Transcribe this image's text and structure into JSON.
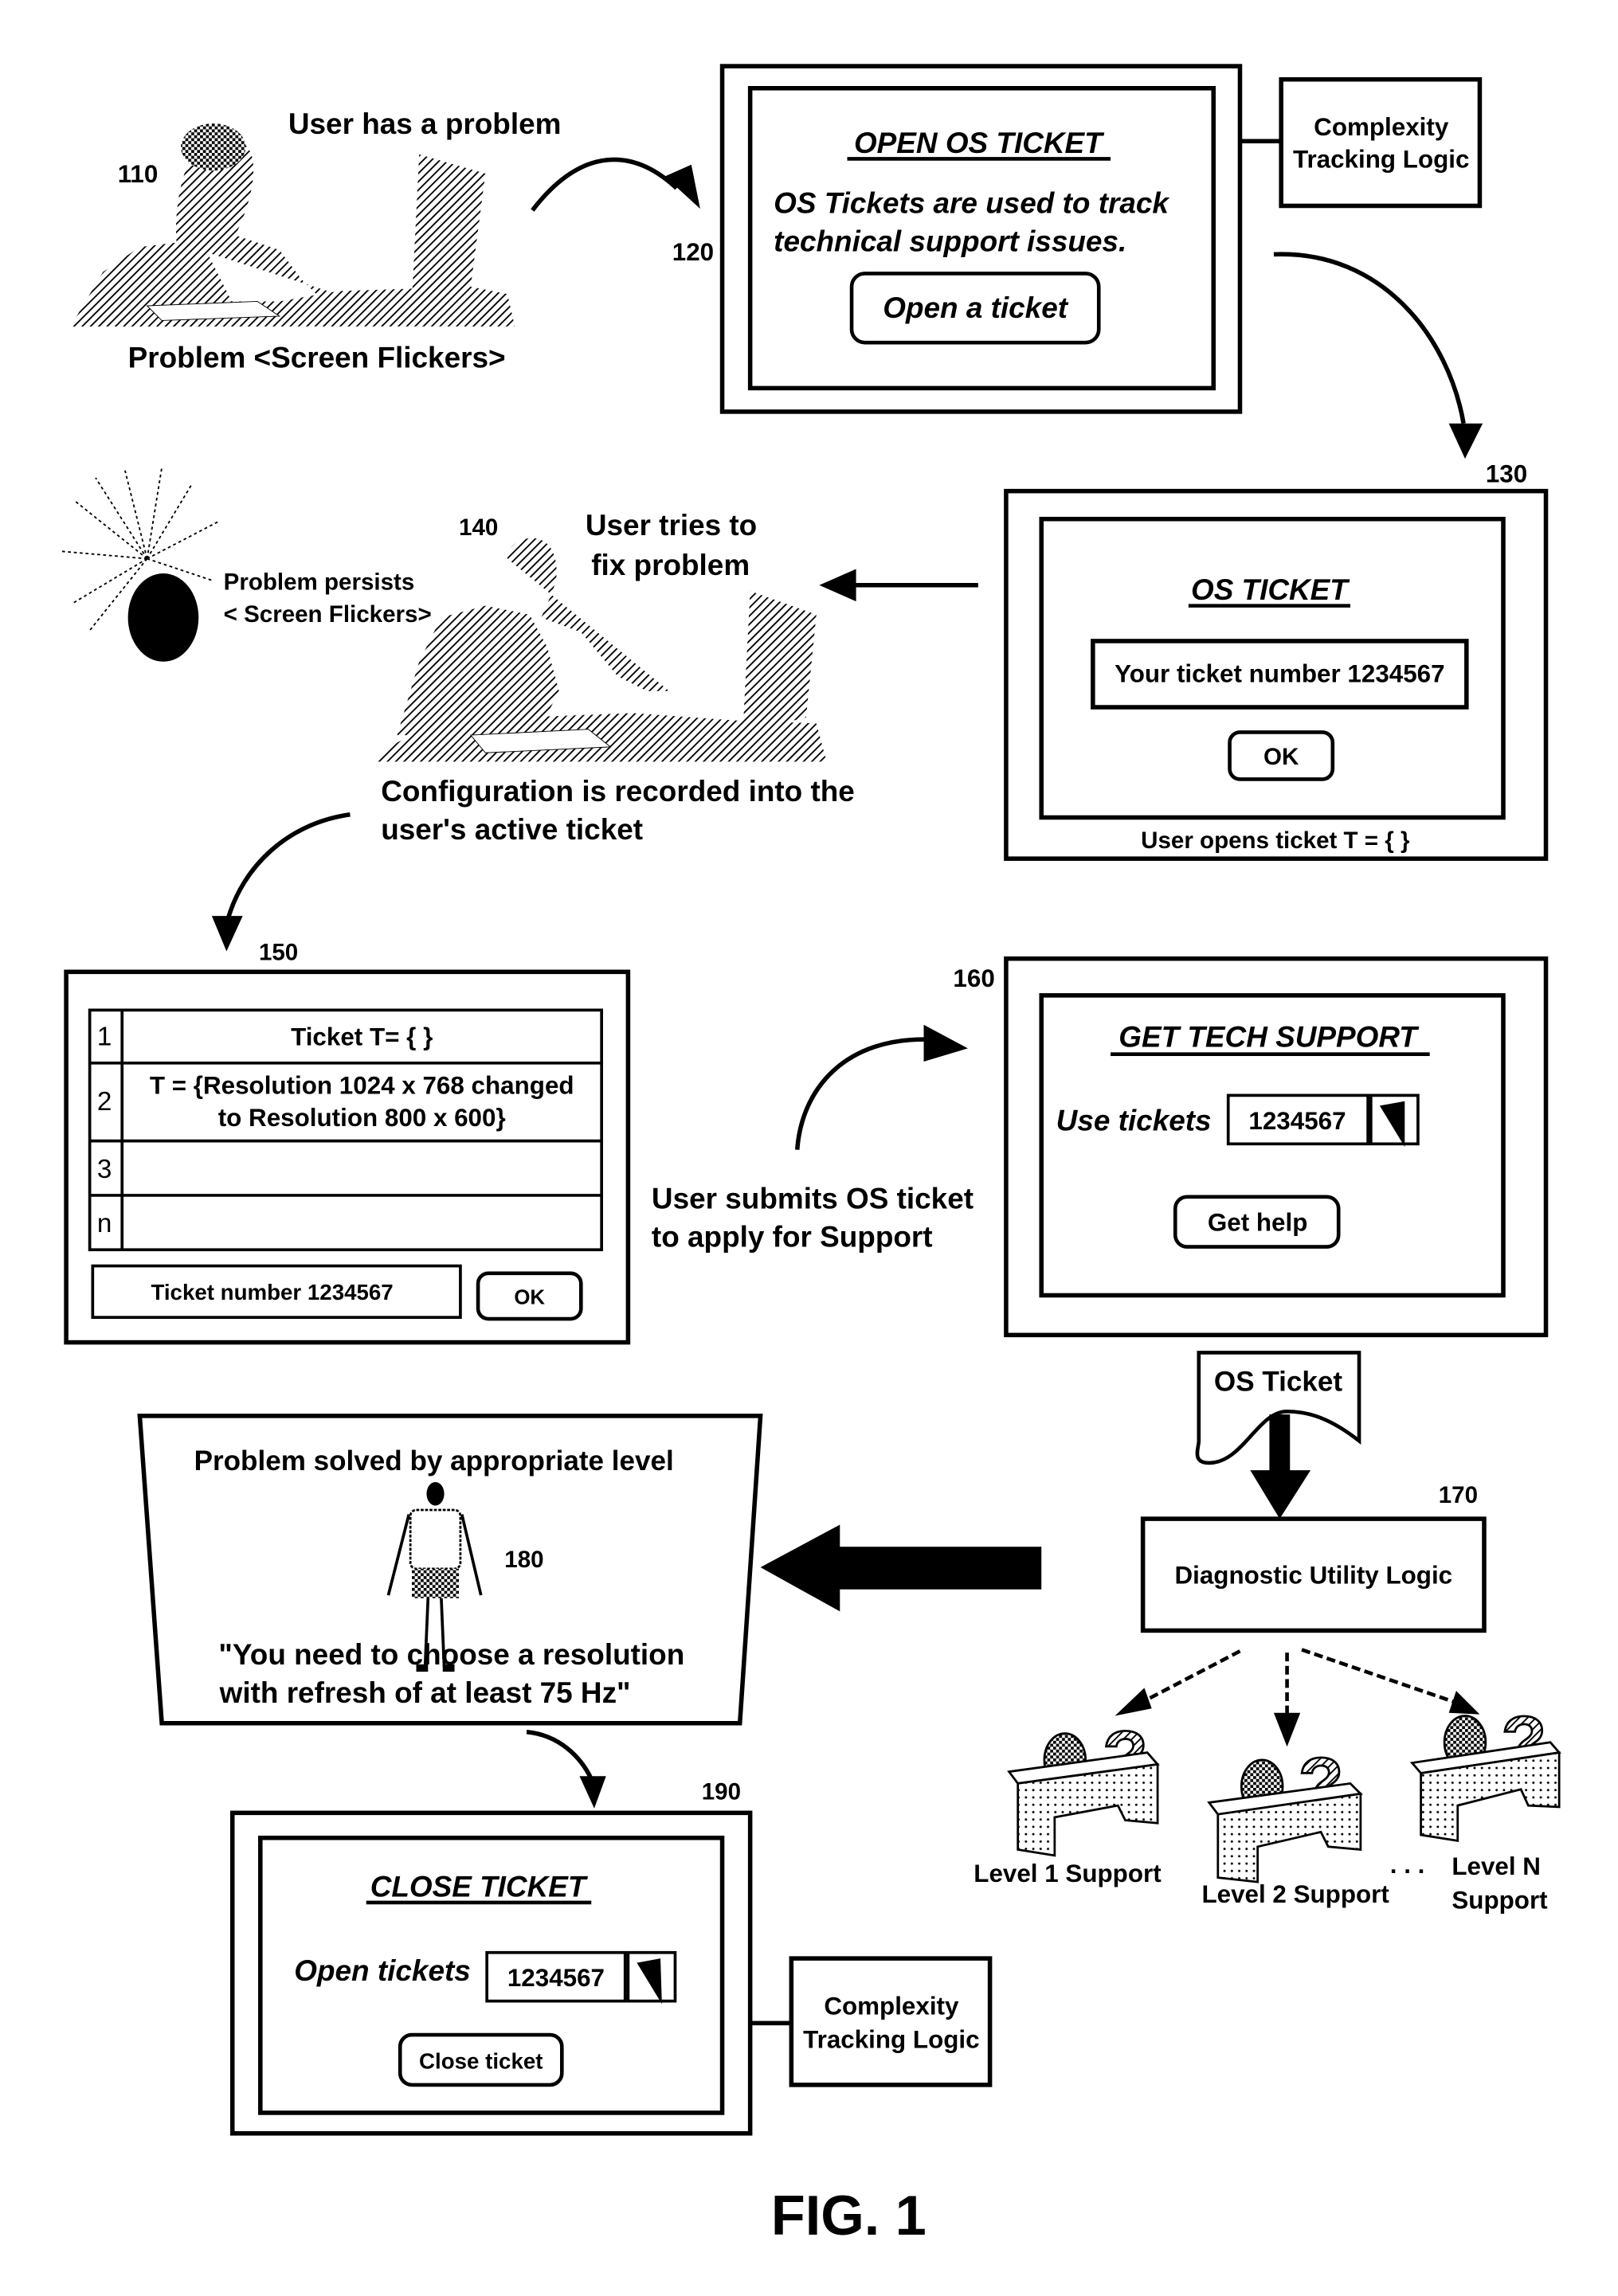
{
  "figure_label": "FIG. 1",
  "colors": {
    "ink": "#000000",
    "paper": "#ffffff",
    "hatch": "#555555",
    "dots": "#888888"
  },
  "step_110": {
    "ref": "110",
    "caption": "User has a problem",
    "problem": "Problem <Screen Flickers>"
  },
  "step_120": {
    "ref": "120",
    "title": "OPEN OS TICKET",
    "description_line1": "OS Tickets are used to track",
    "description_line2": "technical support issues.",
    "button_label": "Open a ticket",
    "side_box_line1": "Complexity",
    "side_box_line2": "Tracking Logic"
  },
  "step_130": {
    "ref": "130",
    "title": "OS TICKET",
    "ticket_field": "Your ticket number 1234567",
    "ok_label": "OK",
    "footer": "User opens ticket T = {  }"
  },
  "step_140": {
    "ref": "140",
    "caption_line1": "User tries to",
    "caption_line2": "fix problem",
    "persist_line1": "Problem persists",
    "persist_line2": "< Screen Flickers>",
    "config_line1": "Configuration is recorded into the",
    "config_line2": "user's active ticket"
  },
  "step_150": {
    "ref": "150",
    "rows": [
      {
        "index": "1",
        "line1": "Ticket T= {  }",
        "line2": ""
      },
      {
        "index": "2",
        "line1": "T = {Resolution 1024 x 768 changed",
        "line2": "to Resolution 800 x 600}"
      },
      {
        "index": "3",
        "line1": "",
        "line2": ""
      },
      {
        "index": "n",
        "line1": "",
        "line2": ""
      }
    ],
    "ticket_field": "Ticket number 1234567",
    "ok_label": "OK"
  },
  "step_160": {
    "ref": "160",
    "submit_line1": "User submits OS ticket",
    "submit_line2": "to apply for Support",
    "title": "GET TECH SUPPORT",
    "field_label": "Use tickets",
    "field_value": "1234567",
    "button_label": "Get help"
  },
  "step_170": {
    "ref": "170",
    "document_label": "OS Ticket",
    "box_label": "Diagnostic Utility Logic",
    "levels": [
      "Level 1 Support",
      "Level 2 Support"
    ],
    "ellipsis": ". . .",
    "level_n_line1": "Level N",
    "level_n_line2": "Support"
  },
  "step_180": {
    "ref": "180",
    "heading": "Problem solved by appropriate level",
    "quote_line1": "\"You need to choose a resolution",
    "quote_line2": "with refresh of at least 75 Hz\""
  },
  "step_190": {
    "ref": "190",
    "title": "CLOSE TICKET",
    "field_label": "Open tickets",
    "field_value": "1234567",
    "button_label": "Close ticket",
    "side_box_line1": "Complexity",
    "side_box_line2": "Tracking Logic"
  }
}
